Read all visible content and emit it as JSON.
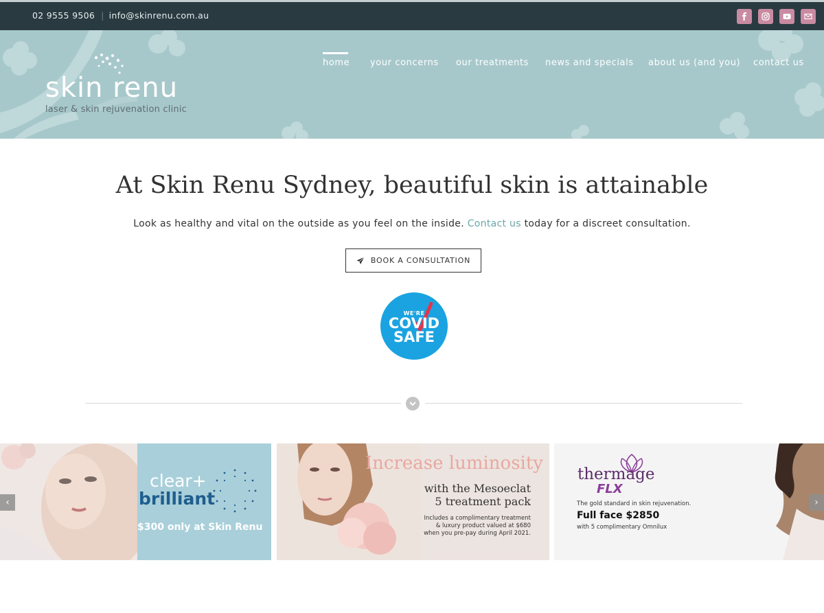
{
  "topbar": {
    "phone": "02 9555 9506",
    "email": "info@skinrenu.com.au",
    "social": [
      "facebook-icon",
      "instagram-icon",
      "youtube-icon",
      "email-icon"
    ]
  },
  "logo": {
    "word": "skin renu",
    "tagline": "laser & skin rejuvenation clinic"
  },
  "nav": {
    "items": [
      "home",
      "your concerns",
      "our treatments",
      "news and specials",
      "about us (and you)",
      "contact us"
    ],
    "active": "home"
  },
  "hero": {
    "title": "At Skin Renu Sydney, beautiful skin is attainable",
    "sub_before": "Look as healthy and vital on the outside as you feel on the inside.",
    "sub_link": "Contact us",
    "sub_after": "today for a discreet consultation.",
    "button": "BOOK A CONSULTATION"
  },
  "badge": {
    "line1": "WE'RE",
    "line2": "COVID",
    "line3": "SAFE"
  },
  "slides": [
    {
      "brand_top": "clear+",
      "brand_bottom": "brilliant",
      "price": "$300 only at Skin Renu"
    },
    {
      "title": "Increase luminosity",
      "line1": "with the Mesoeclat",
      "line2": "5 treatment pack",
      "fine1": "Includes a complimentary treatment",
      "fine2": "& luxury product valued at $680",
      "fine3": "when you pre-pay during April 2021."
    },
    {
      "brand": "thermage",
      "brand_sub": "FLX",
      "tagline": "The gold standard in skin rejuvenation.",
      "price": "Full face $2850",
      "extra": "with 5 complimentary Omnilux"
    }
  ],
  "colors": {
    "topbar": "#2a3a41",
    "header": "#a7c8cb",
    "accent_link": "#6aa6a9",
    "social": "#c98ba2",
    "badge": "#1aa3e0"
  }
}
